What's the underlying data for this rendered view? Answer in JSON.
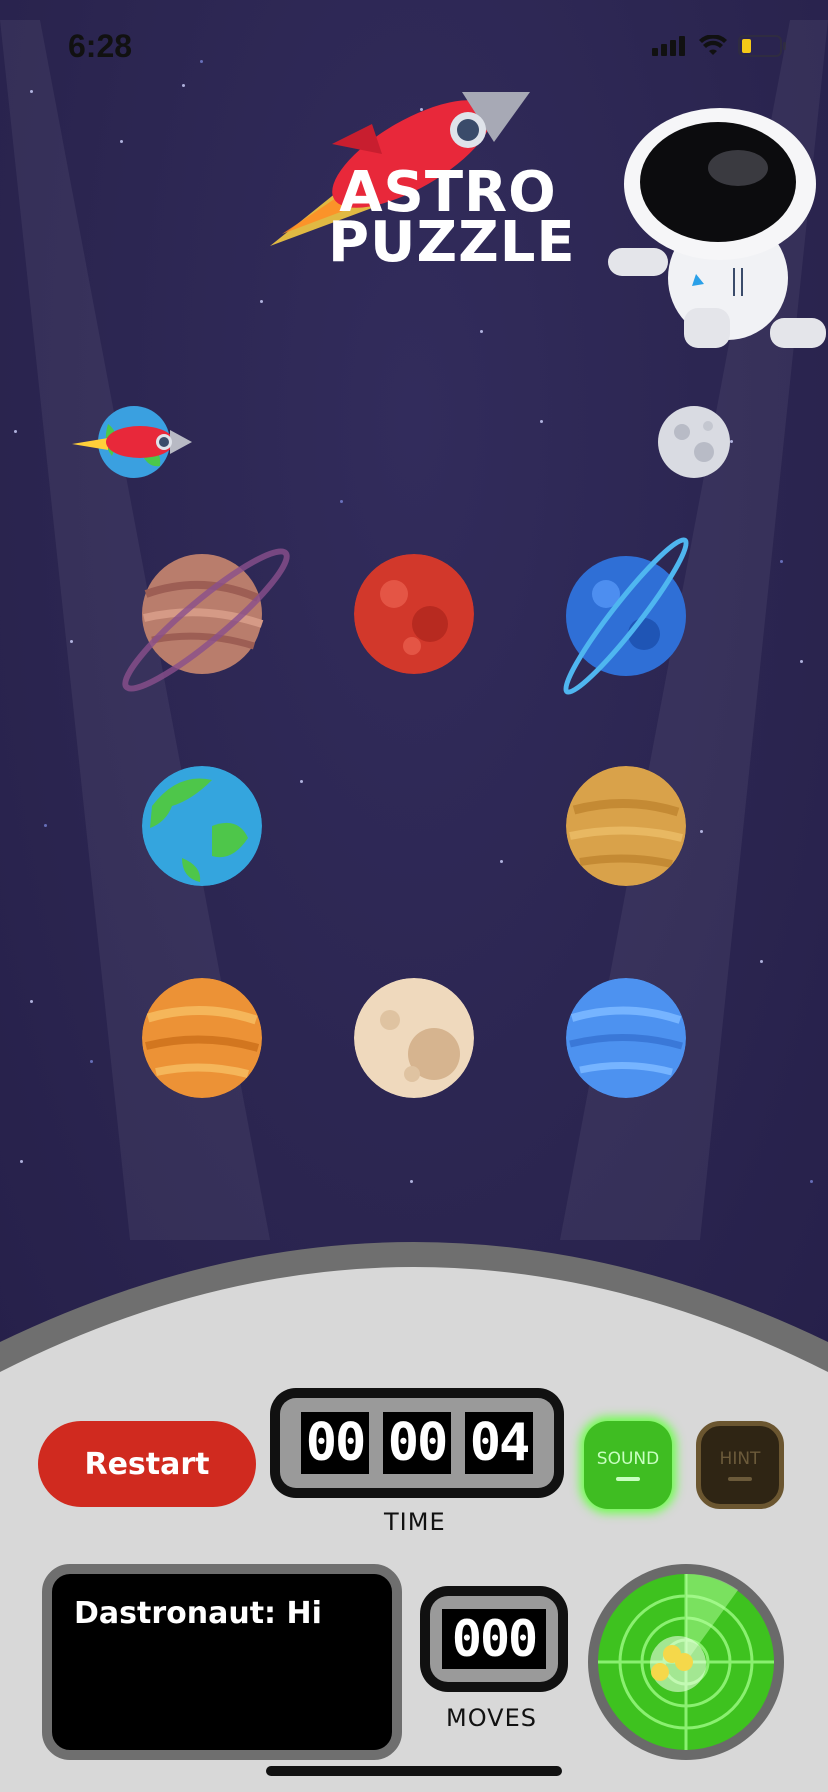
{
  "status_bar": {
    "time": "6:28"
  },
  "logo": {
    "line1": "ASTRO",
    "line2": "PUZZLE"
  },
  "board": {
    "tiles": [
      {
        "name": "saturn-tile",
        "icon": "ringed-planet-brown"
      },
      {
        "name": "mars-tile",
        "icon": "red-planet"
      },
      {
        "name": "neptune-tile",
        "icon": "ringed-planet-blue"
      },
      {
        "name": "earth-tile",
        "icon": "earth-planet"
      },
      {
        "name": "venus-tile",
        "icon": "golden-planet"
      },
      {
        "name": "jupiter-tile",
        "icon": "orange-planet"
      },
      {
        "name": "moon-tile",
        "icon": "cream-planet"
      },
      {
        "name": "uranus-tile",
        "icon": "light-blue-planet"
      }
    ],
    "empty_slot": "row-2-col-2"
  },
  "controls": {
    "restart_label": "Restart",
    "timer": {
      "d1": "00",
      "d2": "00",
      "d3": "04"
    },
    "time_label": "TIME",
    "sound_label": "SOUND",
    "hint_label": "HINT",
    "moves_value": "000",
    "moves_label": "MOVES"
  },
  "chat": {
    "message": "Dastronaut: Hi"
  },
  "colors": {
    "space_bg": "#2c2650",
    "restart": "#d02a1f",
    "sound_active": "#3fbd22",
    "hint_inactive": "#2f2514",
    "radar": "#3ec21f"
  }
}
